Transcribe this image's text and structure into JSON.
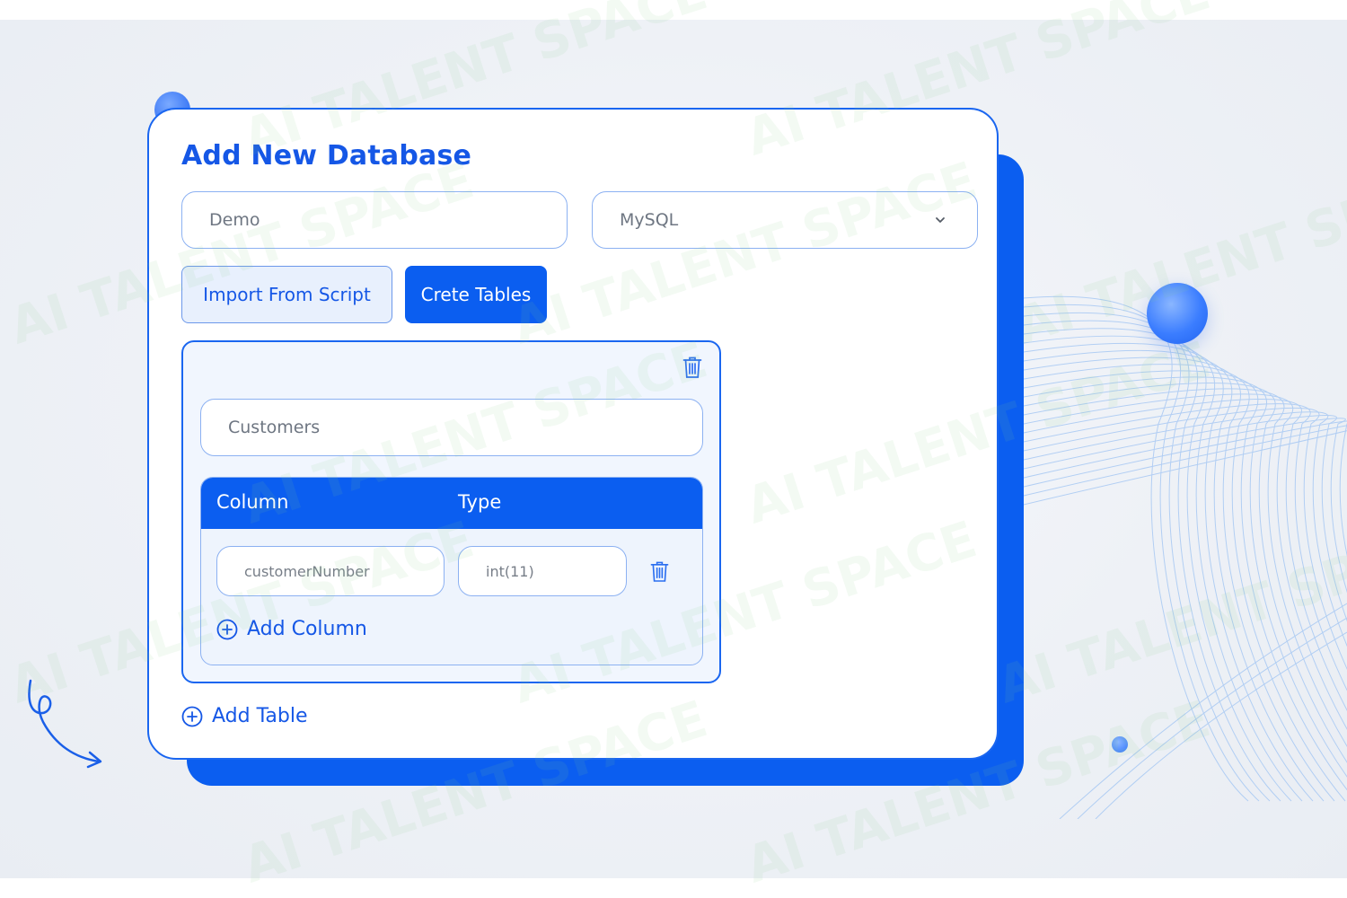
{
  "dialog": {
    "title": "Add New Database",
    "database_name_value": "Demo",
    "database_type_value": "MySQL",
    "import_button_label": "Import From Script",
    "create_button_label": "Crete Tables",
    "table": {
      "name_value": "Customers",
      "column_header": "Column",
      "type_header": "Type",
      "columns": [
        {
          "name": "customerNumber",
          "type": "int(11)"
        }
      ],
      "add_column_label": "Add Column"
    },
    "add_table_label": "Add Table"
  },
  "watermark": {
    "text": "AI TALENT SPACE"
  },
  "colors": {
    "primary": "#0b5ef0",
    "title_blue": "#1557e6",
    "field_border": "#8cb1f2",
    "light_panel": "#f1f6fe"
  },
  "icons": {
    "dropdown": "chevron-down-icon",
    "delete": "trash-icon",
    "add": "plus-circle-icon"
  }
}
